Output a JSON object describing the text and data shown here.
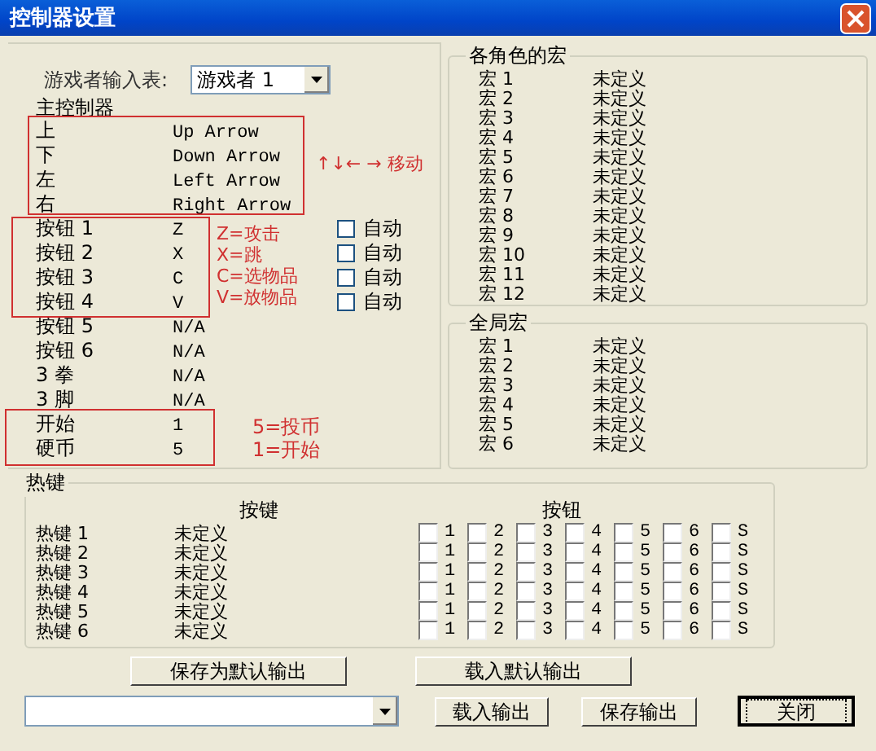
{
  "window": {
    "title": "控制器设置"
  },
  "player_select": {
    "label": "游戏者输入表:",
    "value": "游戏者 1"
  },
  "main_controller": {
    "title": "主控制器",
    "rows": [
      {
        "name": "上",
        "key": "Up Arrow"
      },
      {
        "name": "下",
        "key": "Down Arrow"
      },
      {
        "name": "左",
        "key": "Left Arrow"
      },
      {
        "name": "右",
        "key": "Right Arrow"
      },
      {
        "name": "按钮 1",
        "key": "Z",
        "auto": {
          "label": "自动",
          "checked": false
        }
      },
      {
        "name": "按钮 2",
        "key": "X",
        "auto": {
          "label": "自动",
          "checked": false
        }
      },
      {
        "name": "按钮 3",
        "key": "C",
        "auto": {
          "label": "自动",
          "checked": false
        }
      },
      {
        "name": "按钮 4",
        "key": "V",
        "auto": {
          "label": "自动",
          "checked": false
        }
      },
      {
        "name": "按钮 5",
        "key": "N/A"
      },
      {
        "name": "按钮 6",
        "key": "N/A"
      },
      {
        "name": "3 拳",
        "key": "N/A"
      },
      {
        "name": "3 脚",
        "key": "N/A"
      },
      {
        "name": "开始",
        "key": "1"
      },
      {
        "name": "硬币",
        "key": "5"
      }
    ]
  },
  "character_macros": {
    "title": "各角色的宏",
    "rows": [
      {
        "name": "宏 1",
        "value": "未定义"
      },
      {
        "name": "宏 2",
        "value": "未定义"
      },
      {
        "name": "宏 3",
        "value": "未定义"
      },
      {
        "name": "宏 4",
        "value": "未定义"
      },
      {
        "name": "宏 5",
        "value": "未定义"
      },
      {
        "name": "宏 6",
        "value": "未定义"
      },
      {
        "name": "宏 7",
        "value": "未定义"
      },
      {
        "name": "宏 8",
        "value": "未定义"
      },
      {
        "name": "宏 9",
        "value": "未定义"
      },
      {
        "name": "宏 10",
        "value": "未定义"
      },
      {
        "name": "宏 11",
        "value": "未定义"
      },
      {
        "name": "宏 12",
        "value": "未定义"
      }
    ]
  },
  "global_macros": {
    "title": "全局宏",
    "rows": [
      {
        "name": "宏 1",
        "value": "未定义"
      },
      {
        "name": "宏 2",
        "value": "未定义"
      },
      {
        "name": "宏 3",
        "value": "未定义"
      },
      {
        "name": "宏 4",
        "value": "未定义"
      },
      {
        "name": "宏 5",
        "value": "未定义"
      },
      {
        "name": "宏 6",
        "value": "未定义"
      }
    ]
  },
  "hotkeys": {
    "title": "热键",
    "key_heading": "按键",
    "button_heading": "按钮",
    "rows": [
      {
        "name": "热键 1",
        "key": "未定义",
        "buttons": [
          {
            "label": "1",
            "checked": false
          },
          {
            "label": "2",
            "checked": false
          },
          {
            "label": "3",
            "checked": false
          },
          {
            "label": "4",
            "checked": false
          },
          {
            "label": "5",
            "checked": false
          },
          {
            "label": "6",
            "checked": false
          },
          {
            "label": "S",
            "checked": false
          }
        ]
      },
      {
        "name": "热键 2",
        "key": "未定义",
        "buttons": [
          {
            "label": "1",
            "checked": false
          },
          {
            "label": "2",
            "checked": false
          },
          {
            "label": "3",
            "checked": false
          },
          {
            "label": "4",
            "checked": false
          },
          {
            "label": "5",
            "checked": false
          },
          {
            "label": "6",
            "checked": false
          },
          {
            "label": "S",
            "checked": false
          }
        ]
      },
      {
        "name": "热键 3",
        "key": "未定义",
        "buttons": [
          {
            "label": "1",
            "checked": false
          },
          {
            "label": "2",
            "checked": false
          },
          {
            "label": "3",
            "checked": false
          },
          {
            "label": "4",
            "checked": false
          },
          {
            "label": "5",
            "checked": false
          },
          {
            "label": "6",
            "checked": false
          },
          {
            "label": "S",
            "checked": false
          }
        ]
      },
      {
        "name": "热键 4",
        "key": "未定义",
        "buttons": [
          {
            "label": "1",
            "checked": false
          },
          {
            "label": "2",
            "checked": false
          },
          {
            "label": "3",
            "checked": false
          },
          {
            "label": "4",
            "checked": false
          },
          {
            "label": "5",
            "checked": false
          },
          {
            "label": "6",
            "checked": false
          },
          {
            "label": "S",
            "checked": false
          }
        ]
      },
      {
        "name": "热键 5",
        "key": "未定义",
        "buttons": [
          {
            "label": "1",
            "checked": false
          },
          {
            "label": "2",
            "checked": false
          },
          {
            "label": "3",
            "checked": false
          },
          {
            "label": "4",
            "checked": false
          },
          {
            "label": "5",
            "checked": false
          },
          {
            "label": "6",
            "checked": false
          },
          {
            "label": "S",
            "checked": false
          }
        ]
      },
      {
        "name": "热键 6",
        "key": "未定义",
        "buttons": [
          {
            "label": "1",
            "checked": false
          },
          {
            "label": "2",
            "checked": false
          },
          {
            "label": "3",
            "checked": false
          },
          {
            "label": "4",
            "checked": false
          },
          {
            "label": "5",
            "checked": false
          },
          {
            "label": "6",
            "checked": false
          },
          {
            "label": "S",
            "checked": false
          }
        ]
      }
    ]
  },
  "default_buttons": [
    {
      "label": "保存为默认输出"
    },
    {
      "label": "载入默认输出"
    }
  ],
  "bottom_buttons": [
    {
      "label": "载入输出",
      "focused": false
    },
    {
      "label": "保存输出",
      "focused": false
    },
    {
      "label": "关闭",
      "focused": true
    }
  ],
  "annotations": [
    {
      "lines": [
        "↑↓← → 移动"
      ]
    },
    {
      "lines": [
        "Z=攻击",
        "X=跳",
        "C=选物品",
        "V=放物品"
      ]
    },
    {
      "lines": [
        "5=投币",
        "1=开始"
      ]
    }
  ]
}
